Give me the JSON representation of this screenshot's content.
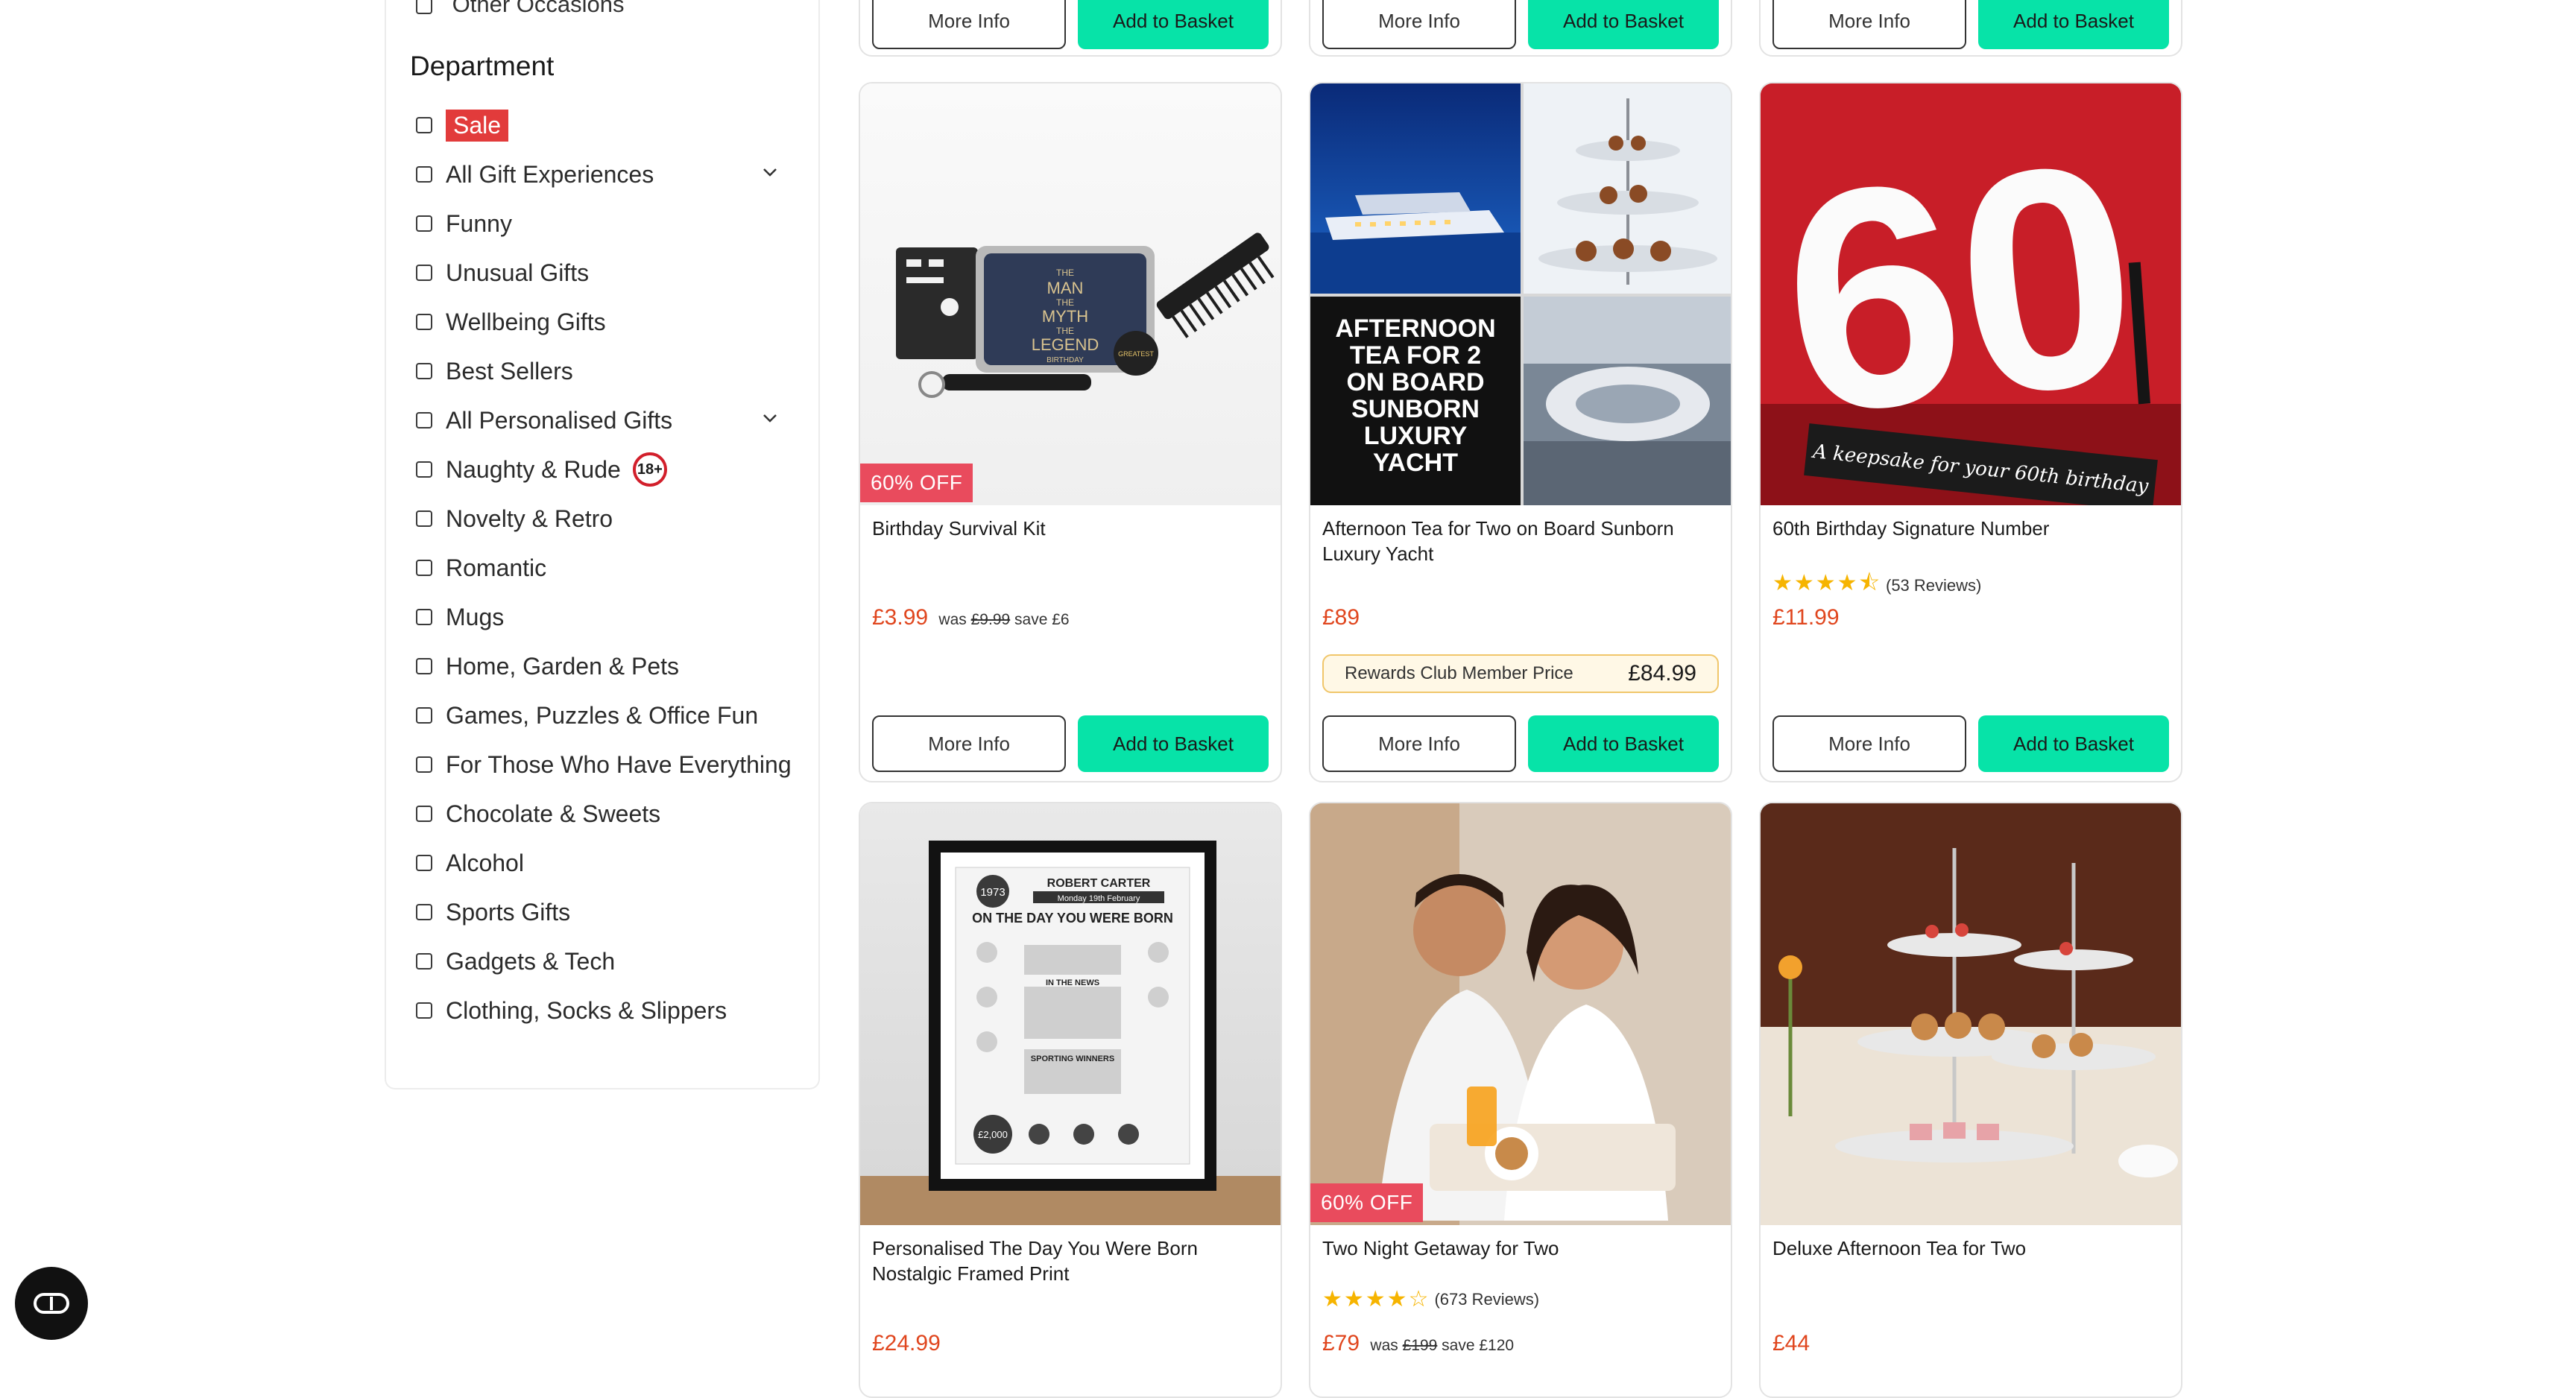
{
  "sidebar": {
    "previous_item": "Other Occasions",
    "department_title": "Department",
    "items": [
      {
        "label": "Sale",
        "highlight": true
      },
      {
        "label": "All Gift Experiences",
        "expandable": true
      },
      {
        "label": "Funny"
      },
      {
        "label": "Unusual Gifts"
      },
      {
        "label": "Wellbeing Gifts"
      },
      {
        "label": "Best Sellers"
      },
      {
        "label": "All Personalised Gifts",
        "expandable": true
      },
      {
        "label": "Naughty & Rude",
        "badge": "18+"
      },
      {
        "label": "Novelty & Retro"
      },
      {
        "label": "Romantic"
      },
      {
        "label": "Mugs"
      },
      {
        "label": "Home, Garden & Pets"
      },
      {
        "label": "Games, Puzzles & Office Fun"
      },
      {
        "label": "For Those Who Have Everything"
      },
      {
        "label": "Chocolate & Sweets"
      },
      {
        "label": "Alcohol"
      },
      {
        "label": "Sports Gifts"
      },
      {
        "label": "Gadgets & Tech"
      },
      {
        "label": "Clothing, Socks & Slippers"
      }
    ]
  },
  "buttons": {
    "more_info": "More Info",
    "add_to_basket": "Add to Basket"
  },
  "products": [
    {
      "name": "Birthday Survival Kit",
      "price": "£3.99",
      "was_prefix": "was",
      "was_price": "£9.99",
      "save": "save £6",
      "discount_badge": "60% OFF",
      "image_text": [
        "THE",
        "MAN",
        "THE",
        "MYTH",
        "THE",
        "LEGEND",
        "BIRTHDAY",
        "GREATEST"
      ]
    },
    {
      "name": "Afternoon Tea for Two on Board Sunborn Luxury Yacht",
      "price": "£89",
      "rewards_label": "Rewards Club Member Price",
      "rewards_price": "£84.99",
      "image_text": [
        "AFTERNOON",
        "TEA FOR 2",
        "ON BOARD",
        "SUNBORN",
        "LUXURY",
        "YACHT"
      ]
    },
    {
      "name": "60th Birthday Signature Number",
      "rating": 4.5,
      "stars": "★★★★⯪",
      "reviews": "(53 Reviews)",
      "price": "£11.99",
      "image_text": [
        "60",
        "A keepsake for your 60th birthday"
      ]
    },
    {
      "name": "Personalised The Day You Were Born Nostalgic Framed Print",
      "price": "£24.99",
      "image_text": [
        "1973",
        "ROBERT CARTER",
        "Monday 19th February",
        "ON THE DAY YOU WERE BORN",
        "IN THE NEWS",
        "SPORTING WINNERS",
        "£2,000"
      ]
    },
    {
      "name": "Two Night Getaway for Two",
      "rating": 4,
      "stars": "★★★★☆",
      "reviews": "(673 Reviews)",
      "price": "£79",
      "was_prefix": "was",
      "was_price": "£199",
      "save": "save £120",
      "discount_badge": "60% OFF"
    },
    {
      "name": "Deluxe Afternoon Tea for Two",
      "price": "£44"
    }
  ],
  "colors": {
    "accent_green": "#07e3a8",
    "price_red": "#e0461e",
    "sale_red": "#e23b3b",
    "badge_pink": "#e94b5d"
  },
  "chat_icon": "chat-toggle-icon"
}
